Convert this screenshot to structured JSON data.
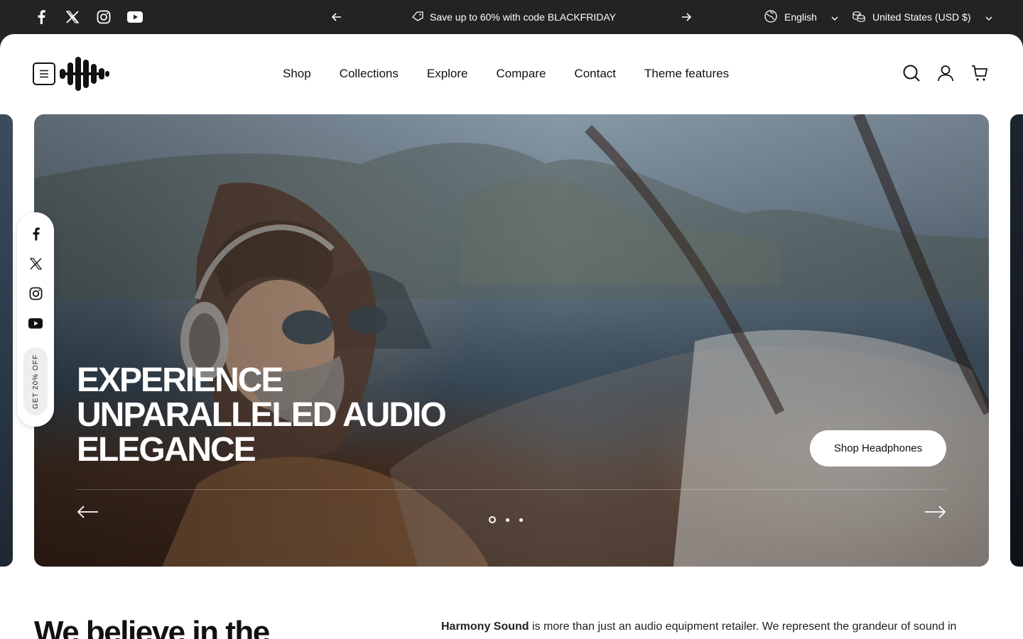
{
  "announcement": {
    "socials": [
      "facebook-icon",
      "x-icon",
      "instagram-icon",
      "youtube-icon"
    ],
    "text": "Save up to 60% with code BLACKFRIDAY",
    "language": "English",
    "currency": "United States (USD $)"
  },
  "header": {
    "nav": [
      "Shop",
      "Collections",
      "Explore",
      "Compare",
      "Contact",
      "Theme features"
    ],
    "icons": [
      "search-icon",
      "account-icon",
      "cart-icon"
    ]
  },
  "hero": {
    "title_lines": [
      "EXPERIENCE",
      "UNPARALLELED AUDIO",
      "ELEGANCE"
    ],
    "button": "Shop Headphones",
    "slides": 3,
    "active_slide": 1
  },
  "floating": {
    "promo": "GET 20% OFF"
  },
  "intro": {
    "heading": "We believe in the",
    "brand": "Harmony Sound",
    "text": " is more than just an audio equipment retailer. We represent the grandeur of sound in"
  },
  "colors": {
    "topbar": "#232323",
    "text": "#111111",
    "button_bg": "#ffffff"
  }
}
